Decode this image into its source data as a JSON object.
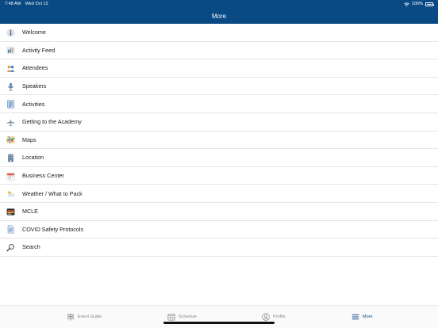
{
  "status_bar": {
    "time": "7:48 AM",
    "date": "Wed Oct 12",
    "battery_text": "100%"
  },
  "nav": {
    "title": "More"
  },
  "menu": {
    "items": [
      {
        "label": "Welcome",
        "icon": "info-icon"
      },
      {
        "label": "Activity Feed",
        "icon": "activity-feed-icon"
      },
      {
        "label": "Attendees",
        "icon": "attendees-icon"
      },
      {
        "label": "Speakers",
        "icon": "microphone-icon"
      },
      {
        "label": "Activities",
        "icon": "activities-list-icon"
      },
      {
        "label": "Getting to the Academy",
        "icon": "airplane-icon"
      },
      {
        "label": "Maps",
        "icon": "map-icon"
      },
      {
        "label": "Location",
        "icon": "location-icon"
      },
      {
        "label": "Business Center",
        "icon": "business-center-icon"
      },
      {
        "label": "Weather / What to Pack",
        "icon": "weather-icon"
      },
      {
        "label": "MCLE",
        "icon": "mcle-icon"
      },
      {
        "label": "COVID Safety Protocols",
        "icon": "document-icon"
      },
      {
        "label": "Search",
        "icon": "search-icon"
      }
    ]
  },
  "tab_bar": {
    "tabs": [
      {
        "label": "Event Guide",
        "icon": "event-guide-icon",
        "active": false
      },
      {
        "label": "Schedule",
        "icon": "calendar-icon",
        "active": false
      },
      {
        "label": "Profile",
        "icon": "profile-icon",
        "active": false
      },
      {
        "label": "More",
        "icon": "more-menu-icon",
        "active": true
      }
    ]
  },
  "colors": {
    "header": "#0a4a84",
    "active_tab": "#0a4a84",
    "inactive_tab": "#8a8a8a",
    "divider": "#e4e4e4"
  }
}
